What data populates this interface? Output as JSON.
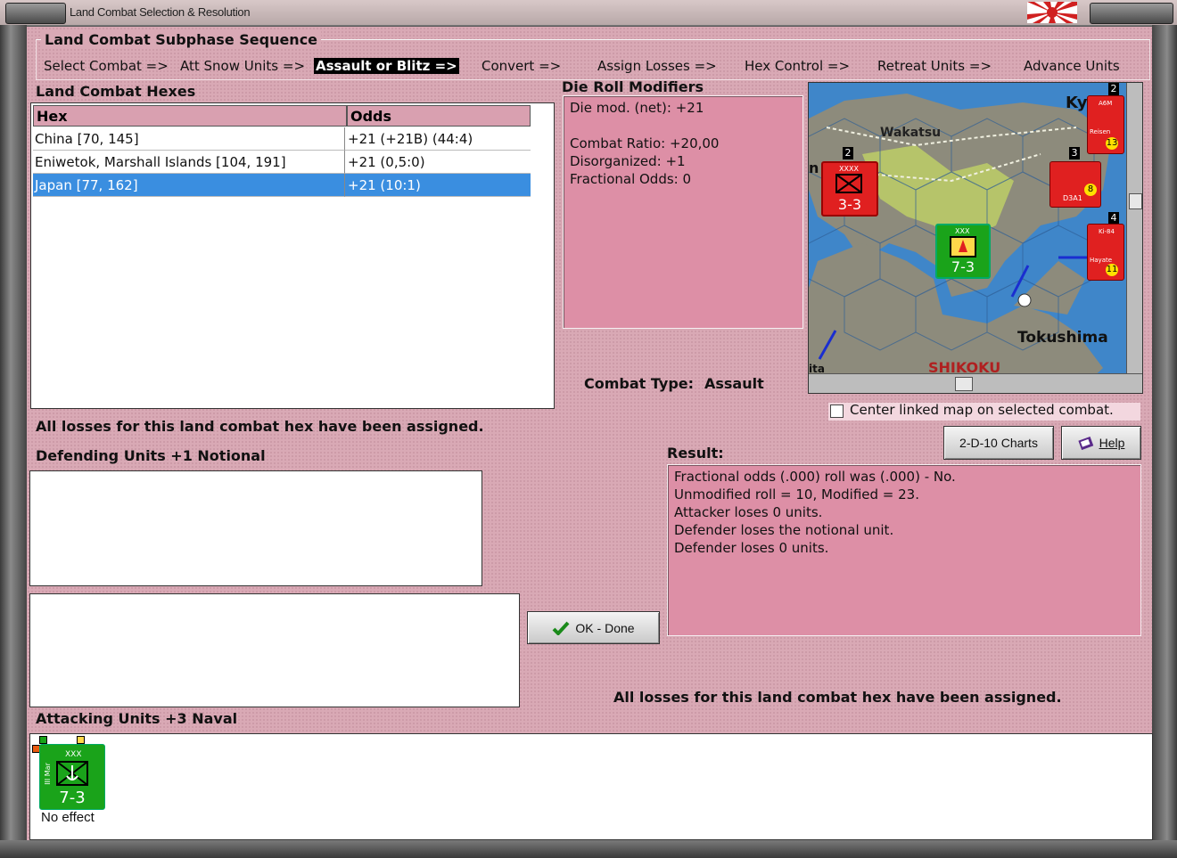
{
  "window": {
    "title": "Land Combat Selection & Resolution"
  },
  "sequence": {
    "title": "Land Combat Subphase Sequence",
    "steps": [
      {
        "label": "Select Combat =>"
      },
      {
        "label": "Att Snow Units =>"
      },
      {
        "label": "Assault or Blitz =>"
      },
      {
        "label": "Convert =>"
      },
      {
        "label": "Assign Losses =>"
      },
      {
        "label": "Hex Control =>"
      },
      {
        "label": "Retreat Units =>"
      },
      {
        "label": "Advance Units"
      }
    ],
    "active_index": 2
  },
  "hexes": {
    "title": "Land Combat Hexes",
    "columns": [
      "Hex",
      "Odds"
    ],
    "rows": [
      {
        "hex": "China [70, 145]",
        "odds": "+21 (+21B) (44:4)"
      },
      {
        "hex": "Eniwetok, Marshall Islands [104, 191]",
        "odds": "+21 (0,5:0)"
      },
      {
        "hex": "Japan [77, 162]",
        "odds": "+21 (10:1)"
      }
    ],
    "selected_index": 2
  },
  "modifiers": {
    "title": "Die Roll Modifiers",
    "net": "Die mod. (net): +21",
    "lines": [
      "Combat Ratio: +20,00",
      "Disorganized: +1",
      "Fractional Odds: 0"
    ]
  },
  "combat_type": {
    "label": "Combat Type:",
    "value": "Assault"
  },
  "map": {
    "labels": {
      "wakatsu": "Wakatsu",
      "tokushima": "Tokushima",
      "shikoku": "SHIKOKU",
      "ky": "Ky",
      "n": "n",
      "ita": "ita"
    },
    "units": [
      {
        "value": "3-3",
        "color": "#e02020"
      },
      {
        "value": "7-3",
        "color": "#1aa31a"
      }
    ],
    "stack_counts": [
      "2",
      "2",
      "3",
      "4"
    ],
    "air_values": [
      "13",
      "8",
      "11"
    ],
    "marker_texts": [
      "XXXX",
      "XXX",
      "D3A1",
      "Ki-84",
      "Hayate",
      "Reisen",
      "A6M"
    ]
  },
  "center_linked": {
    "label": "Center linked map on selected combat.",
    "checked": false
  },
  "buttons": {
    "charts": "2-D-10 Charts",
    "help": "Help",
    "ok": "OK - Done"
  },
  "losses_assigned_top": "All losses for this land combat hex have been assigned.",
  "losses_assigned_bottom": "All losses for this land combat hex have been assigned.",
  "defending": {
    "title": "Defending Units +1 Notional"
  },
  "result": {
    "title": "Result:",
    "lines": [
      "Fractional odds (.000) roll was (.000)  - No.",
      "Unmodified roll = 10, Modified = 23.",
      "Attacker loses 0 units.",
      "Defender loses the notional unit.",
      "Defender loses 0 units."
    ]
  },
  "attacking": {
    "title": "Attacking Units +3 Naval",
    "units": [
      {
        "value": "7-3",
        "side_text": "III Mar",
        "size": "XXX",
        "status": "No effect",
        "color": "#1aa31a"
      }
    ]
  }
}
